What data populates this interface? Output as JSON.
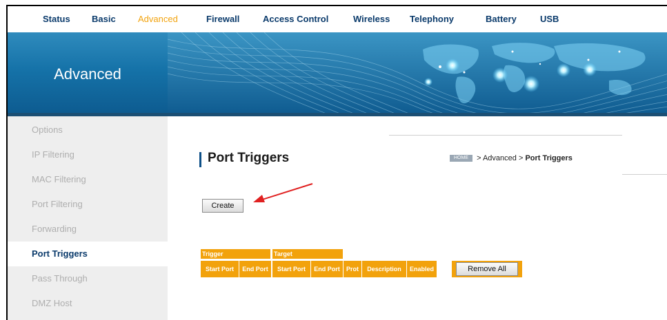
{
  "topnav": {
    "items": [
      {
        "label": "Status"
      },
      {
        "label": "Basic"
      },
      {
        "label": "Advanced"
      },
      {
        "label": "Firewall"
      },
      {
        "label": "Access Control"
      },
      {
        "label": "Wireless"
      },
      {
        "label": "Telephony"
      },
      {
        "label": "Battery"
      },
      {
        "label": "USB"
      }
    ],
    "active": "Advanced"
  },
  "banner": {
    "title": "Advanced"
  },
  "sidebar": {
    "items": [
      {
        "label": "Options"
      },
      {
        "label": "IP Filtering"
      },
      {
        "label": "MAC Filtering"
      },
      {
        "label": "Port Filtering"
      },
      {
        "label": "Forwarding"
      },
      {
        "label": "Port Triggers"
      },
      {
        "label": "Pass Through"
      },
      {
        "label": "DMZ Host"
      }
    ],
    "active": "Port Triggers"
  },
  "main": {
    "title": "Port Triggers",
    "breadcrumb": {
      "home_label": "HOME",
      "sep1": ">",
      "section": "Advanced",
      "sep2": ">",
      "current": "Port Triggers"
    },
    "create_label": "Create",
    "table": {
      "group_headers": [
        "Trigger",
        "Target"
      ],
      "columns": [
        "Start Port",
        "End Port",
        "Start Port",
        "End Port",
        "Prot",
        "Description",
        "Enabled"
      ],
      "remove_all_label": "Remove All"
    }
  },
  "colors": {
    "accent": "#f2a20c",
    "nav_text": "#0a3a6b",
    "banner_blue": "#1572a8",
    "arrow": "#e02020"
  }
}
